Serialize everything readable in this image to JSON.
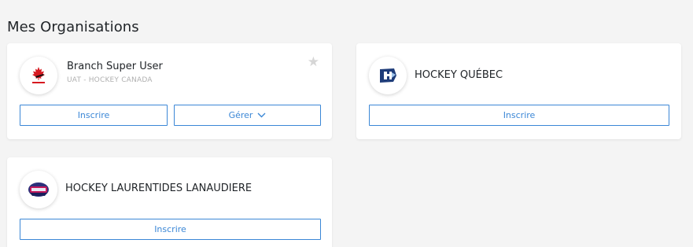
{
  "page": {
    "title": "Mes Organisations"
  },
  "organisations": [
    {
      "name": "Branch Super User",
      "subtitle": "UAT - HOCKEY CANADA",
      "logo_icon": "hockey-canada-logo",
      "favorite_icon": "star-icon",
      "buttons": {
        "inscrire": "Inscrire",
        "gerer": "Gérer"
      }
    },
    {
      "name": "HOCKEY QUÉBEC",
      "logo_icon": "hockey-quebec-logo",
      "buttons": {
        "inscrire": "Inscrire"
      }
    },
    {
      "name": "HOCKEY LAURENTIDES LANAUDIERE",
      "logo_icon": "hockey-laurentides-lanaudiere-logo",
      "buttons": {
        "inscrire": "Inscrire"
      }
    }
  ],
  "colors": {
    "accent": "#3b87d6",
    "background": "#f4f4f4",
    "card": "#ffffff",
    "star": "#d6d6d6",
    "muted": "#b0b0b0"
  },
  "icons": {
    "star": "★"
  }
}
